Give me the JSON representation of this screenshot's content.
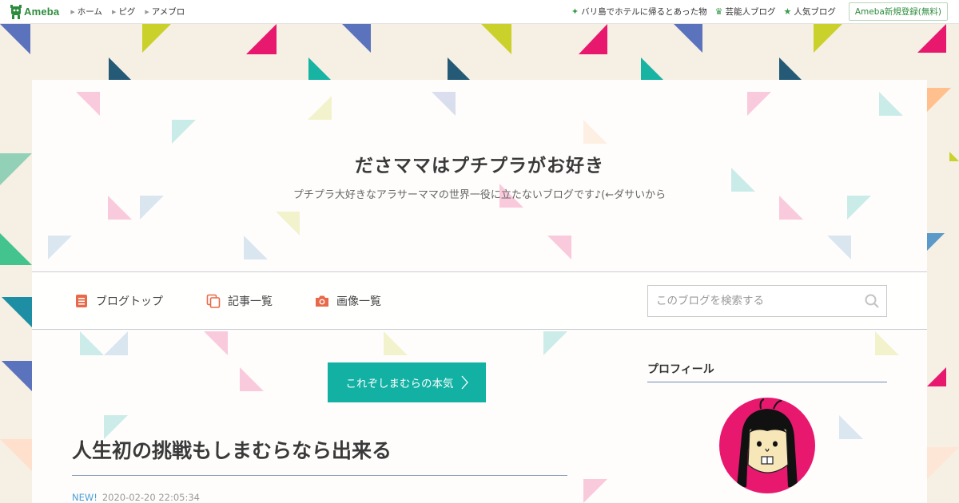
{
  "topbar": {
    "logo_text": "Ameba",
    "nav": [
      "ホーム",
      "ピグ",
      "アメブロ"
    ],
    "links": [
      {
        "icon": "sparkle-icon",
        "label": "バリ島でホテルに帰るとあった物"
      },
      {
        "icon": "crown-icon",
        "label": "芸能人ブログ"
      },
      {
        "icon": "star-icon",
        "label": "人気ブログ"
      }
    ],
    "register_label": "Ameba新規登録(無料)"
  },
  "blog": {
    "title": "ださママはプチプラがお好き",
    "description": "プチプラ大好きなアラサーママの世界一役に立たないブログです♪(←ダサいから"
  },
  "menu": {
    "items": [
      {
        "icon": "document-icon",
        "label": "ブログトップ"
      },
      {
        "icon": "copy-icon",
        "label": "記事一覧"
      },
      {
        "icon": "camera-icon",
        "label": "画像一覧"
      }
    ],
    "search_placeholder": "このブログを検索する"
  },
  "main": {
    "cta_label": "これぞしまむらの本気",
    "article_title": "人生初の挑戦もしまむらなら出来る",
    "new_badge": "NEW!",
    "date": "2020-02-20 22:05:34"
  },
  "sidebar": {
    "profile_heading": "プロフィール"
  },
  "colors": {
    "brand_green": "#2d8c3c",
    "teal_button": "#13b1a3",
    "accent_orange": "#e8694a",
    "avatar_pink": "#e8186f"
  }
}
